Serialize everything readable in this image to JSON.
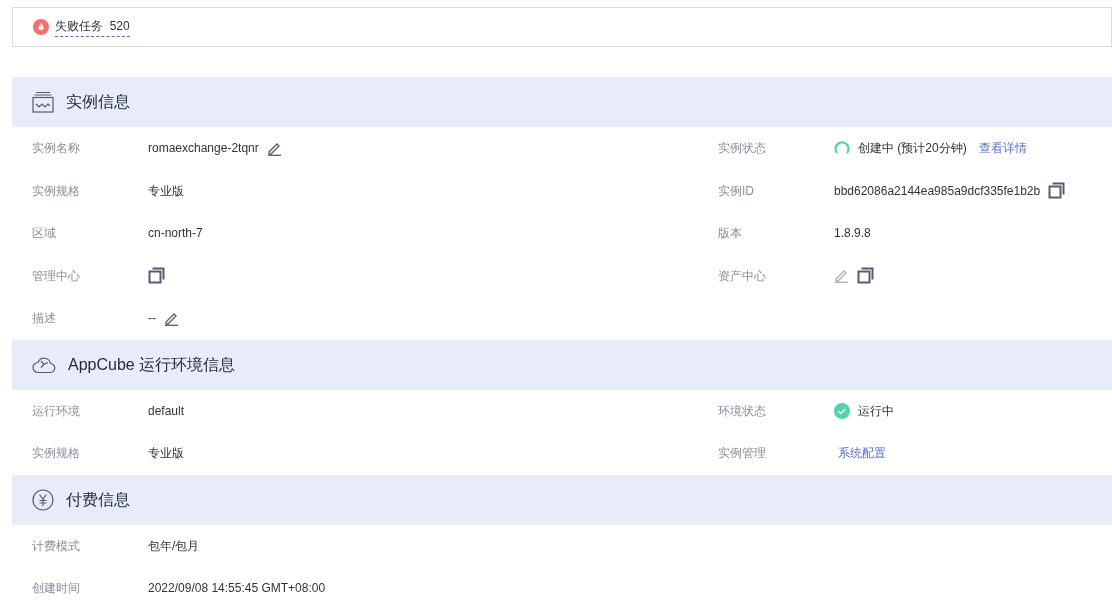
{
  "alert": {
    "label": "失败任务",
    "count": "520"
  },
  "sections": [
    {
      "kind": "monitor",
      "title": "实例信息",
      "rows": [
        {
          "left": {
            "label": "实例名称",
            "items": [
              {
                "kind": "text",
                "text": "romaexchange-2tqnr"
              },
              {
                "kind": "edit",
                "disabled": false
              }
            ]
          },
          "right": {
            "label": "实例状态",
            "items": [
              {
                "kind": "loading"
              },
              {
                "kind": "text",
                "text": "创建中 (预计20分钟)"
              },
              {
                "kind": "link",
                "text": "查看详情"
              }
            ]
          }
        },
        {
          "left": {
            "label": "实例规格",
            "items": [
              {
                "kind": "text",
                "text": "专业版"
              }
            ]
          },
          "right": {
            "label": "实例ID",
            "items": [
              {
                "kind": "text",
                "text": "bbd62086a2144ea985a9dcf335fe1b2b"
              },
              {
                "kind": "copy"
              }
            ]
          }
        },
        {
          "left": {
            "label": "区域",
            "items": [
              {
                "kind": "text",
                "text": "cn-north-7"
              }
            ]
          },
          "right": {
            "label": "版本",
            "items": [
              {
                "kind": "text",
                "text": "1.8.9.8"
              }
            ]
          }
        },
        {
          "left": {
            "label": "管理中心",
            "items": [
              {
                "kind": "copy"
              }
            ]
          },
          "right": {
            "label": "资产中心",
            "items": [
              {
                "kind": "edit",
                "disabled": true
              },
              {
                "kind": "copy"
              }
            ]
          }
        },
        {
          "left": {
            "label": "描述",
            "items": [
              {
                "kind": "text",
                "text": "--"
              },
              {
                "kind": "edit",
                "disabled": false
              }
            ]
          }
        }
      ]
    },
    {
      "kind": "cloud",
      "title": "AppCube 运行环境信息",
      "rows": [
        {
          "left": {
            "label": "运行环境",
            "items": [
              {
                "kind": "text",
                "text": "default"
              }
            ]
          },
          "right": {
            "label": "环境状态",
            "items": [
              {
                "kind": "ok"
              },
              {
                "kind": "text",
                "text": "运行中"
              }
            ]
          }
        },
        {
          "left": {
            "label": "实例规格",
            "items": [
              {
                "kind": "text",
                "text": "专业版"
              }
            ]
          },
          "right": {
            "label": "实例管理",
            "items": [
              {
                "kind": "link",
                "text": "系统配置"
              }
            ]
          }
        }
      ]
    },
    {
      "kind": "yen",
      "title": "付费信息",
      "rows": [
        {
          "left": {
            "label": "计费模式",
            "items": [
              {
                "kind": "text",
                "text": "包年/包月"
              }
            ]
          }
        },
        {
          "left": {
            "label": "创建时间",
            "items": [
              {
                "kind": "text",
                "text": "2022/09/08 14:55:45 GMT+08:00"
              }
            ]
          }
        }
      ]
    }
  ]
}
